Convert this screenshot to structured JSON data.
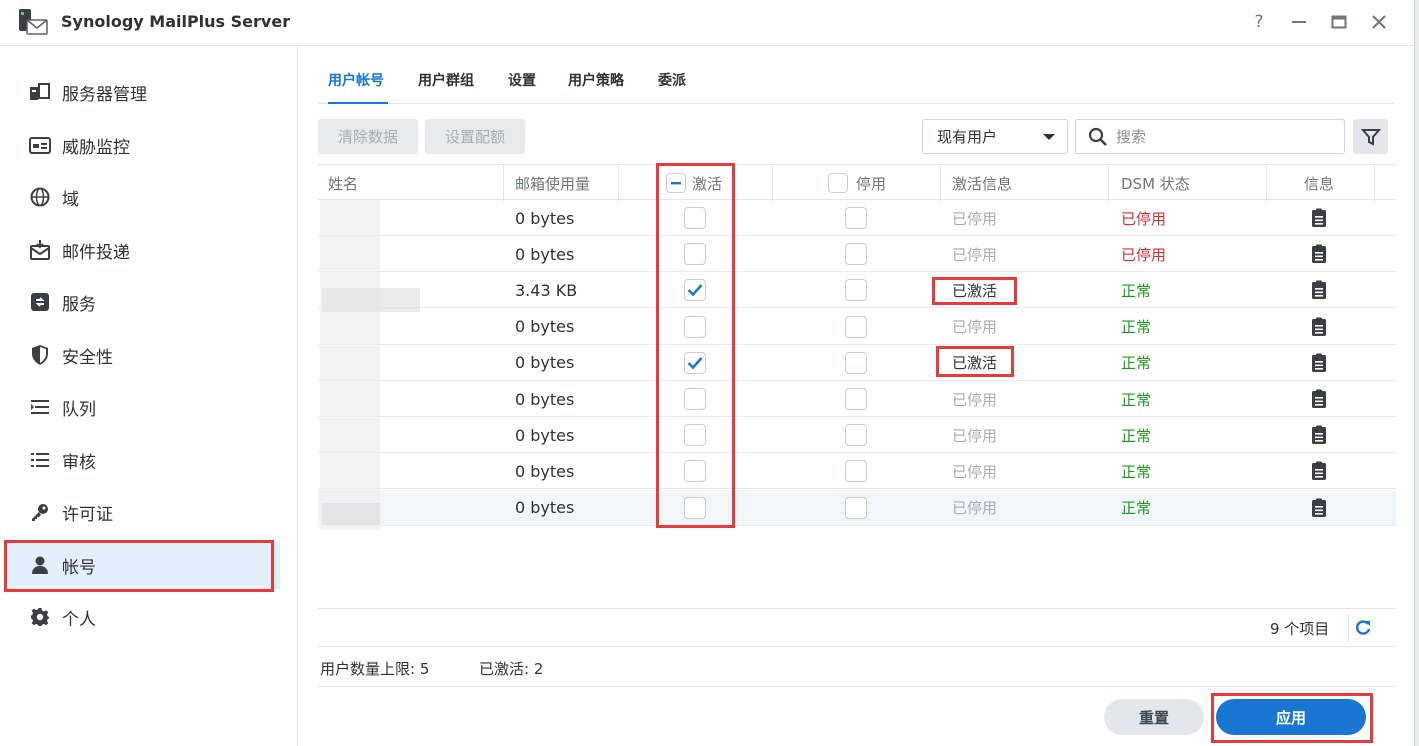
{
  "window": {
    "title": "Synology MailPlus Server",
    "help": "?",
    "minimize": "—",
    "maximize": "▭",
    "close": "✕"
  },
  "sidebar": {
    "items": [
      {
        "label": "服务器管理",
        "icon": "server-icon"
      },
      {
        "label": "威胁监控",
        "icon": "threat-monitor-icon"
      },
      {
        "label": "域",
        "icon": "globe-icon"
      },
      {
        "label": "邮件投递",
        "icon": "mail-delivery-icon"
      },
      {
        "label": "服务",
        "icon": "service-icon"
      },
      {
        "label": "安全性",
        "icon": "shield-icon"
      },
      {
        "label": "队列",
        "icon": "queue-icon"
      },
      {
        "label": "审核",
        "icon": "audit-icon"
      },
      {
        "label": "许可证",
        "icon": "key-icon"
      },
      {
        "label": "帐号",
        "icon": "user-icon",
        "active": true
      },
      {
        "label": "个人",
        "icon": "gear-icon"
      }
    ]
  },
  "tabs": [
    {
      "label": "用户帐号",
      "active": true
    },
    {
      "label": "用户群组"
    },
    {
      "label": "设置"
    },
    {
      "label": "用户策略"
    },
    {
      "label": "委派"
    }
  ],
  "toolbar": {
    "clear_label": "清除数据",
    "quota_label": "设置配额",
    "filter_select": "现有用户",
    "search_placeholder": "搜索"
  },
  "table": {
    "headers": {
      "name": "姓名",
      "usage": "邮箱使用量",
      "activate": "激活",
      "disable": "停用",
      "activation_info": "激活信息",
      "dsm_status": "DSM 状态",
      "info": "信息"
    },
    "rows": [
      {
        "usage": "0 bytes",
        "activated": false,
        "info": "已停用",
        "dsm": "已停用",
        "dsm_color": "red"
      },
      {
        "usage": "0 bytes",
        "activated": false,
        "info": "已停用",
        "dsm": "已停用",
        "dsm_color": "red"
      },
      {
        "usage": "3.43 KB",
        "activated": true,
        "info": "已激活",
        "dsm": "正常",
        "dsm_color": "green"
      },
      {
        "usage": "0 bytes",
        "activated": false,
        "info": "已停用",
        "dsm": "正常",
        "dsm_color": "green"
      },
      {
        "usage": "0 bytes",
        "activated": true,
        "info": "已激活",
        "dsm": "正常",
        "dsm_color": "green"
      },
      {
        "usage": "0 bytes",
        "activated": false,
        "info": "已停用",
        "dsm": "正常",
        "dsm_color": "green"
      },
      {
        "usage": "0 bytes",
        "activated": false,
        "info": "已停用",
        "dsm": "正常",
        "dsm_color": "green"
      },
      {
        "usage": "0 bytes",
        "activated": false,
        "info": "已停用",
        "dsm": "正常",
        "dsm_color": "green"
      },
      {
        "usage": "0 bytes",
        "activated": false,
        "info": "已停用",
        "dsm": "正常",
        "dsm_color": "green"
      }
    ]
  },
  "footer": {
    "count": "9 个项目",
    "user_limit": "用户数量上限: 5",
    "activated_count": "已激活: 2",
    "reset_label": "重置",
    "apply_label": "应用"
  },
  "colors": {
    "accent": "#1976d2",
    "red": "#d32f2f",
    "green": "#1a9e1a",
    "annotation": "#e73b3b"
  }
}
